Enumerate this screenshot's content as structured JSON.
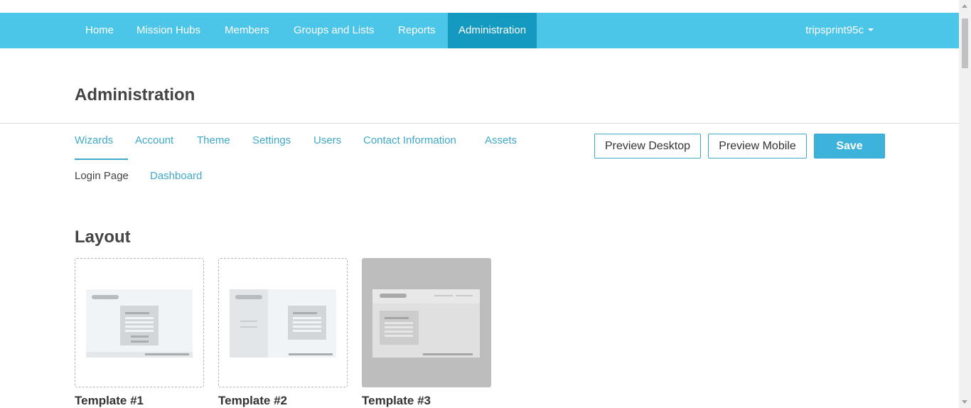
{
  "topnav": {
    "items": [
      {
        "label": "Home"
      },
      {
        "label": "Mission Hubs"
      },
      {
        "label": "Members"
      },
      {
        "label": "Groups and Lists"
      },
      {
        "label": "Reports"
      },
      {
        "label": "Administration",
        "active": true
      }
    ],
    "user": "tripsprint95c",
    "color": "#4bc5e8",
    "active_color": "#1499c1"
  },
  "page": {
    "title": "Administration"
  },
  "subnav": {
    "row1": [
      "Wizards",
      "Account",
      "Theme",
      "Settings",
      "Users",
      "Contact Information",
      "Assets"
    ],
    "row2": [
      "Login Page",
      "Dashboard"
    ],
    "active": "Wizards",
    "current_subtab": "Login Page"
  },
  "actions": {
    "preview_desktop": "Preview Desktop",
    "preview_mobile": "Preview Mobile",
    "save": "Save"
  },
  "layout": {
    "title": "Layout",
    "templates": [
      {
        "label": "Template #1",
        "selected": false,
        "icon": "template-centered-icon"
      },
      {
        "label": "Template #2",
        "selected": false,
        "icon": "template-sidebar-icon"
      },
      {
        "label": "Template #3",
        "selected": true,
        "icon": "template-header-icon"
      }
    ]
  }
}
